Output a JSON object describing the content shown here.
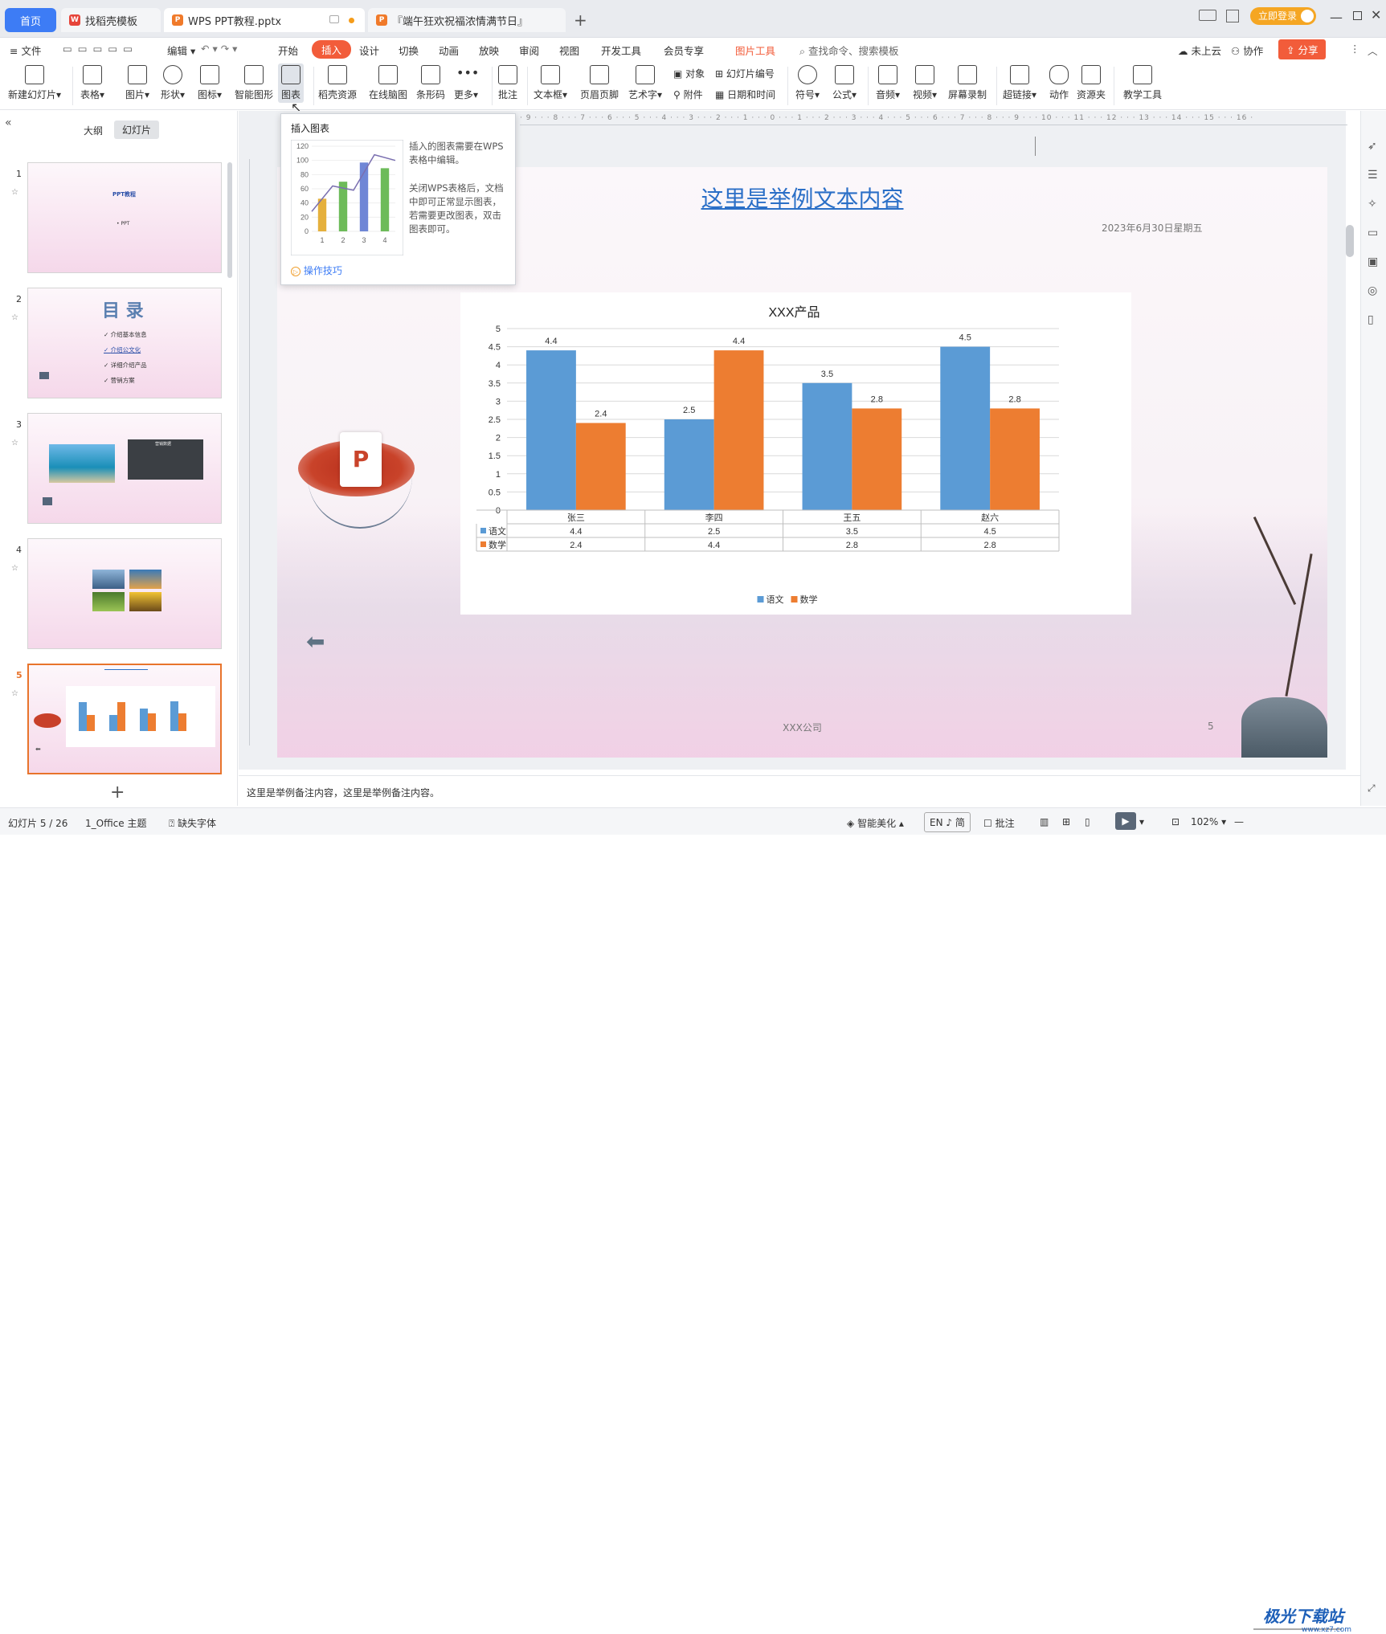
{
  "tabs": {
    "home": "首页",
    "t1": "找稻壳模板",
    "t2": "WPS PPT教程.pptx",
    "t3": "『端午狂欢祝福浓情满节日』",
    "login": "立即登录"
  },
  "menu": {
    "file": "文件",
    "edit": "编辑",
    "items": [
      "开始",
      "插入",
      "设计",
      "切换",
      "动画",
      "放映",
      "审阅",
      "视图",
      "开发工具",
      "会员专享"
    ],
    "picture_tools": "图片工具",
    "search": "查找命令、搜索模板",
    "cloud": "未上云",
    "collab": "协作",
    "share": "分享"
  },
  "ribbon": {
    "new_slide": "新建幻灯片",
    "table": "表格",
    "picture": "图片",
    "shape": "形状",
    "icon": "图标",
    "smart": "智能图形",
    "chart": "图表",
    "daoke": "稻壳资源",
    "mindmap": "在线脑图",
    "barcode": "条形码",
    "more": "更多",
    "comment": "批注",
    "textbox": "文本框",
    "headerfooter": "页眉页脚",
    "wordart": "艺术字",
    "object": "对象",
    "attach": "附件",
    "slidenum": "幻灯片编号",
    "datetime": "日期和时间",
    "symbol": "符号",
    "formula": "公式",
    "audio": "音频",
    "video": "视频",
    "record": "屏幕录制",
    "hyperlink": "超链接",
    "action": "动作",
    "resource": "资源夹",
    "teach": "教学工具"
  },
  "panel": {
    "outline": "大纲",
    "slides": "幻灯片",
    "nums": [
      "1",
      "2",
      "3",
      "4",
      "5"
    ],
    "t1_title": "PPT教程",
    "t1_sub": "• PPT",
    "t2_title": "目 录",
    "t2_items": [
      "介绍基本信息",
      "介绍公文化",
      "详细介绍产品",
      "营销方案"
    ],
    "t3_title": "营销数据"
  },
  "popup": {
    "title": "插入图表",
    "desc1": "插入的图表需要在WPS表格中编辑。",
    "desc2": "关闭WPS表格后，文档中即可正常显示图表，若需要更改图表，双击图表即可。",
    "tips": "操作技巧",
    "mini_y": [
      "120",
      "100",
      "80",
      "60",
      "40",
      "20",
      "0"
    ],
    "mini_x": [
      "1",
      "2",
      "3",
      "4"
    ]
  },
  "slide": {
    "title": "这里是举例文本内容",
    "date": "2023年6月30日星期五",
    "footer": "XXX公司",
    "page": "5"
  },
  "chart_data": {
    "type": "bar",
    "title": "XXX产品",
    "categories": [
      "张三",
      "李四",
      "王五",
      "赵六"
    ],
    "series": [
      {
        "name": "语文",
        "values": [
          4.4,
          2.5,
          3.5,
          4.5
        ],
        "color": "#5b9bd5"
      },
      {
        "name": "数学",
        "values": [
          2.4,
          4.4,
          2.8,
          2.8
        ],
        "color": "#ed7d31"
      }
    ],
    "ylim": [
      0,
      5
    ],
    "yticks": [
      "0",
      "0.5",
      "1",
      "1.5",
      "2",
      "2.5",
      "3",
      "3.5",
      "4",
      "4.5",
      "5"
    ],
    "data_table": true,
    "legend": "bottom"
  },
  "notes": "这里是举例备注内容，这里是举例备注内容。",
  "status": {
    "slide": "幻灯片 5 / 26",
    "theme": "1_Office 主题",
    "font": "缺失字体",
    "beautify": "智能美化",
    "lang": "EN ♪ 简",
    "comment": "批注",
    "zoom": "102%",
    "watermark": "极光下载站",
    "watermark_url": "www.xz7.com"
  }
}
